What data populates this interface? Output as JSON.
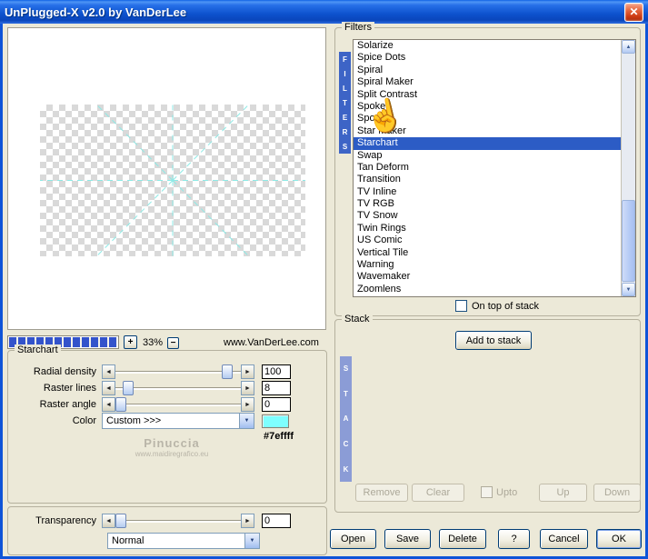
{
  "window": {
    "title": "UnPlugged-X v2.0 by VanDerLee"
  },
  "icons": {
    "close": "✕",
    "arrow_left": "◄",
    "arrow_right": "►",
    "dropdown": "▼",
    "scroll_up": "▲",
    "scroll_down": "▼",
    "pointer_cursor": "☝",
    "plus": "+",
    "minus": "−"
  },
  "preview": {
    "zoom_level": "33%",
    "website": "www.VanDerLee.com"
  },
  "filters": {
    "group_label": "Filters",
    "vertical_label": [
      "F",
      "I",
      "L",
      "T",
      "E",
      "R",
      "S"
    ],
    "items": [
      "Solarize",
      "Spice Dots",
      "Spiral",
      "Spiral Maker",
      "Split Contrast",
      "Spoke",
      "Spot",
      "Star Maker",
      "Starchart",
      "Swap",
      "Tan Deform",
      "Transition",
      "TV Inline",
      "TV RGB",
      "TV Snow",
      "Twin Rings",
      "US Comic",
      "Vertical Tile",
      "Warning",
      "Wavemaker",
      "Zoomlens"
    ],
    "selected": "Starchart",
    "on_top": "On top of stack"
  },
  "params": {
    "group_label": "Starchart",
    "rows": [
      {
        "label": "Radial density",
        "value": "100"
      },
      {
        "label": "Raster lines",
        "value": "8"
      },
      {
        "label": "Raster angle",
        "value": "0"
      }
    ],
    "color_label": "Color",
    "color_value": "Custom >>>",
    "color_hex": "#7effff",
    "watermark_title": "Pinuccia",
    "watermark_url": "www.maidiregrafico.eu",
    "transparency_label": "Transparency",
    "transparency_value": "0",
    "blend_mode": "Normal"
  },
  "stack": {
    "group_label": "Stack",
    "vertical_label": [
      "S",
      "T",
      "A",
      "C",
      "K"
    ],
    "add": "Add to stack",
    "remove": "Remove",
    "clear": "Clear",
    "upto": "Upto",
    "up": "Up",
    "down": "Down"
  },
  "footer": {
    "open": "Open",
    "save": "Save",
    "delete": "Delete",
    "help": "?",
    "cancel": "Cancel",
    "ok": "OK"
  }
}
